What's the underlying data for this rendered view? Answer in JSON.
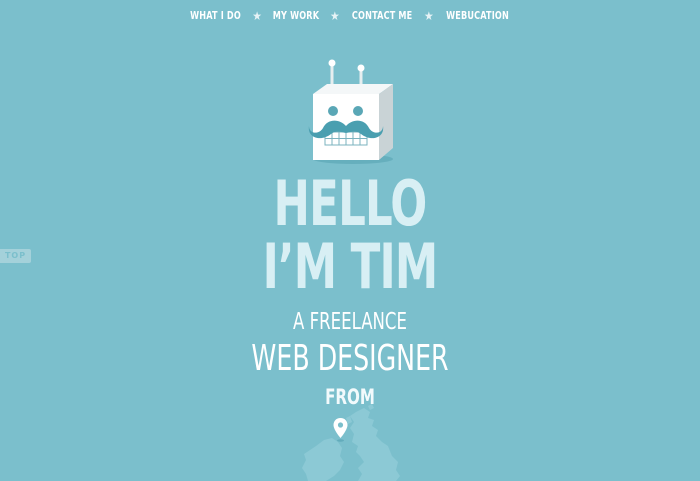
{
  "nav": {
    "items": [
      {
        "label": "WHAT I DO"
      },
      {
        "label": "MY WORK"
      },
      {
        "label": "CONTACT ME"
      },
      {
        "label": "WEBUCATION"
      }
    ],
    "separator": "★"
  },
  "sidebar": {
    "top_label": "TOP"
  },
  "hero": {
    "line1": "HELLO",
    "line2": "I’M TIM",
    "tagline1": "A FREELANCE",
    "tagline2": "WEB DESIGNER",
    "tagline3": "FROM"
  },
  "icons": {
    "robot": "robot-mustache-icon",
    "location": "map-pin-icon",
    "map": "uk-ireland-map"
  },
  "colors": {
    "background": "#7bbfcc",
    "headline": "#d8eff4",
    "text": "#ffffff"
  }
}
